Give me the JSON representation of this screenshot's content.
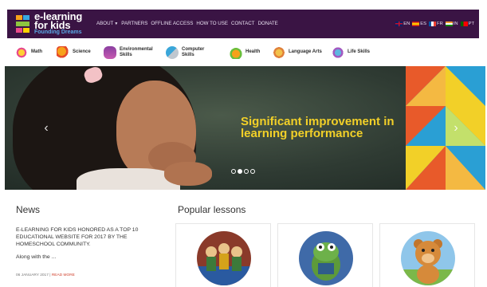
{
  "brand": {
    "name_line1": "e-learning",
    "name_line2": "for kids",
    "tagline": "Founding Dreams",
    "bar_color": "#3a1444",
    "tagline_color": "#5aa9e6"
  },
  "nav": {
    "items": [
      {
        "label": "ABOUT",
        "has_dropdown": true
      },
      {
        "label": "PARTNERS"
      },
      {
        "label": "OFFLINE ACCESS"
      },
      {
        "label": "HOW TO USE"
      },
      {
        "label": "CONTACT"
      },
      {
        "label": "DONATE"
      }
    ]
  },
  "languages": [
    {
      "code": "EN"
    },
    {
      "code": "ES"
    },
    {
      "code": "FR"
    },
    {
      "code": "IN"
    },
    {
      "code": "PT"
    }
  ],
  "categories": [
    {
      "label": "Math",
      "icon": "math-icon"
    },
    {
      "label": "Science",
      "icon": "science-icon"
    },
    {
      "label": "Environmental\nSkills",
      "icon": "environmental-icon"
    },
    {
      "label": "Computer\nSkills",
      "icon": "computer-icon"
    },
    {
      "label": "Health",
      "icon": "health-icon"
    },
    {
      "label": "Language Arts",
      "icon": "language-arts-icon"
    },
    {
      "label": "Life Skills",
      "icon": "life-skills-icon"
    }
  ],
  "hero": {
    "headline": "Significant improvement in learning performance",
    "headline_color": "#f2d028",
    "slide_count": 4,
    "active_slide": 1
  },
  "news": {
    "title": "News",
    "headline": "E-LEARNING FOR KIDS HONORED AS A TOP 10 EDUCATIONAL WEBSITE FOR 2017 BY THE HOMESCHOOL COMMUNITY.",
    "excerpt": "Along with the ...",
    "date": "06 JANUARY 2017",
    "separator": "|",
    "read_more": "READ MORE"
  },
  "popular": {
    "title": "Popular lessons"
  }
}
